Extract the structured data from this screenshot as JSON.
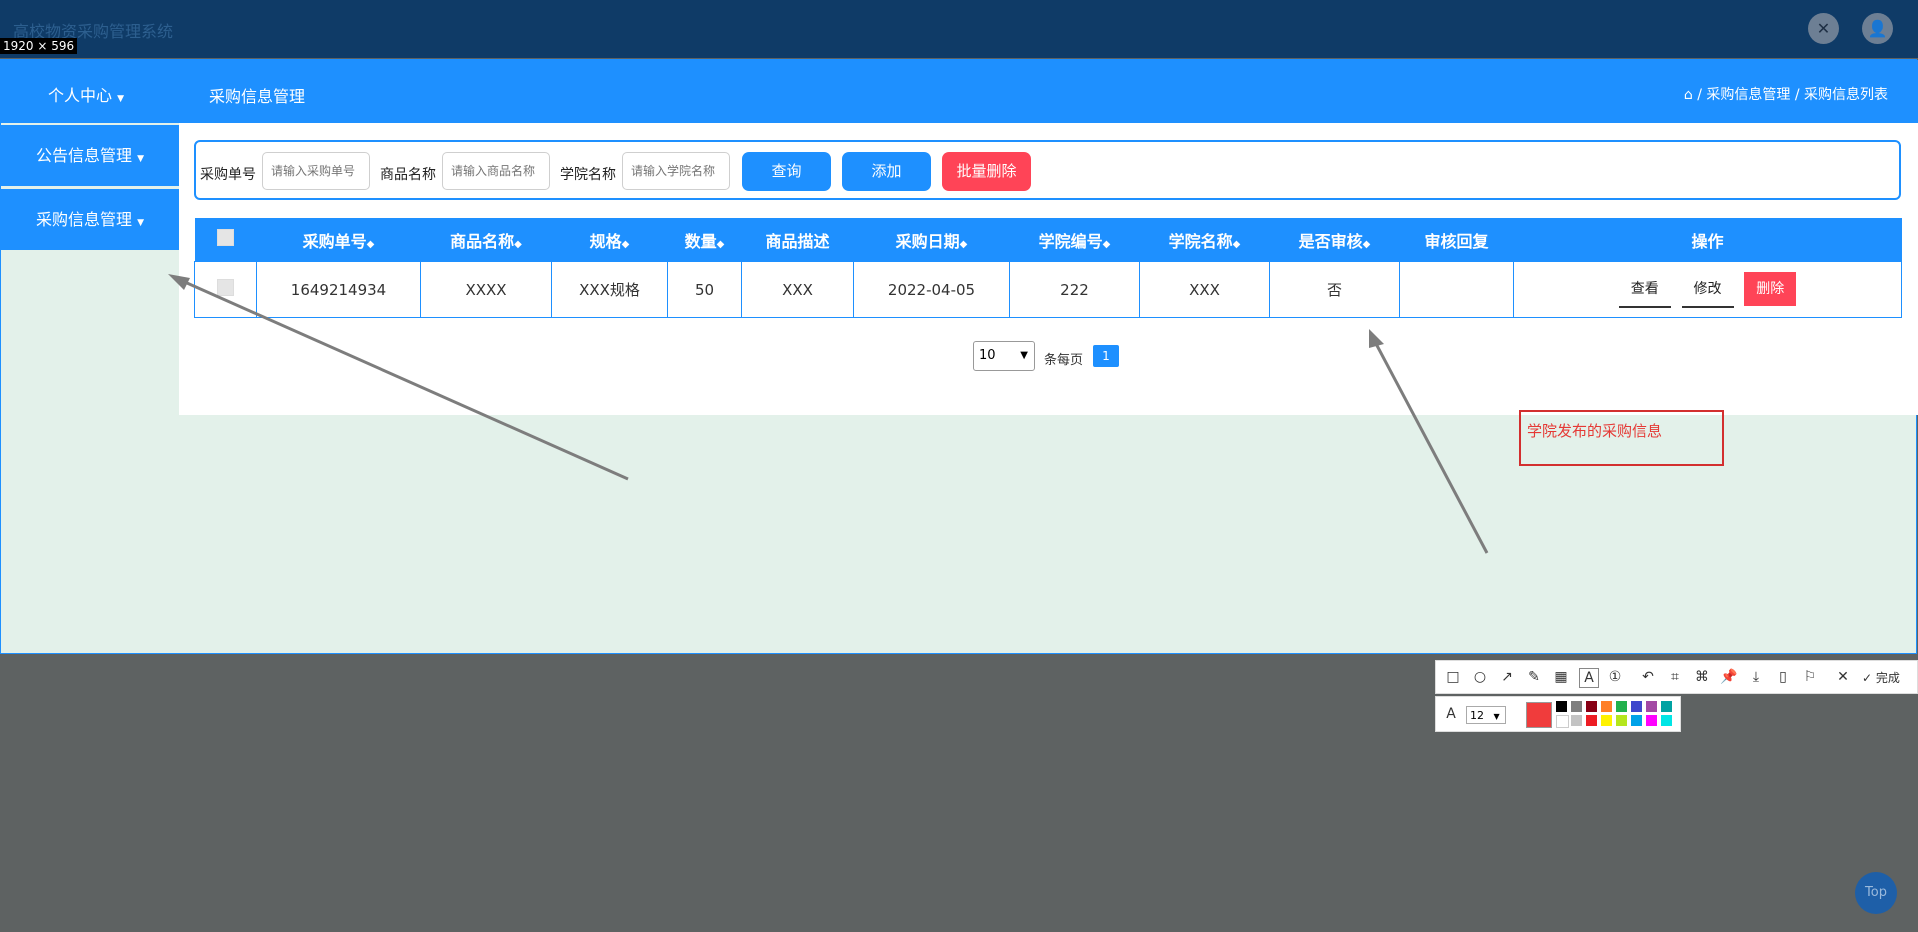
{
  "app": {
    "title": "高校物资采购管理系统",
    "dimension_badge": "1920 × 596"
  },
  "navbar": {
    "personal_center": "个人中心",
    "section_title": "采购信息管理",
    "breadcrumb": [
      "采购信息管理",
      "采购信息列表"
    ]
  },
  "sidebar": {
    "items": [
      {
        "label": "公告信息管理"
      },
      {
        "label": "采购信息管理"
      }
    ]
  },
  "search": {
    "fields": [
      {
        "label": "采购单号",
        "placeholder": "请输入采购单号"
      },
      {
        "label": "商品名称",
        "placeholder": "请输入商品名称"
      },
      {
        "label": "学院名称",
        "placeholder": "请输入学院名称"
      }
    ],
    "buttons": {
      "query": "查询",
      "add": "添加",
      "batch_delete": "批量删除"
    }
  },
  "table": {
    "headers": [
      "采购单号",
      "商品名称",
      "规格",
      "数量",
      "商品描述",
      "采购日期",
      "学院编号",
      "学院名称",
      "是否审核",
      "审核回复",
      "操作"
    ],
    "rows": [
      {
        "order_no": "1649214934",
        "product": "XXXX",
        "spec": "XXX规格",
        "qty": "50",
        "desc": "XXX",
        "date": "2022-04-05",
        "college_no": "222",
        "college": "XXX",
        "audited": "否",
        "reply": ""
      }
    ],
    "actions": {
      "view": "查看",
      "edit": "修改",
      "delete": "删除"
    }
  },
  "pagination": {
    "page_size": "10",
    "per_page_label": "条每页",
    "current_page": "1"
  },
  "annotation": {
    "text": "学院发布的采购信息"
  },
  "screenshot_toolbar": {
    "done_label": "完成",
    "font_size": "12"
  },
  "top_button": "Top",
  "colors": {
    "primary": "#1e90ff",
    "topbar": "#0f3b67",
    "danger": "#ff4457",
    "annotation": "#e53935"
  }
}
